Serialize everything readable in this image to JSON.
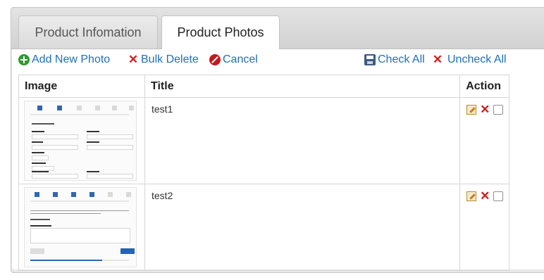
{
  "tabs": [
    {
      "label": "Product Infomation",
      "active": false
    },
    {
      "label": "Product Photos",
      "active": true
    }
  ],
  "toolbar": {
    "add_label": "Add New Photo",
    "bulk_delete_label": "Bulk Delete",
    "cancel_label": "Cancel",
    "check_all_label": "Check All",
    "uncheck_all_label": "Uncheck All"
  },
  "table": {
    "headers": {
      "image": "Image",
      "title": "Title",
      "action": "Action"
    },
    "rows": [
      {
        "title": "test1",
        "checked": false
      },
      {
        "title": "test2",
        "checked": false
      }
    ]
  },
  "colors": {
    "link": "#1f6fba",
    "delete": "#d21e1e",
    "add": "#2e9a2e"
  }
}
